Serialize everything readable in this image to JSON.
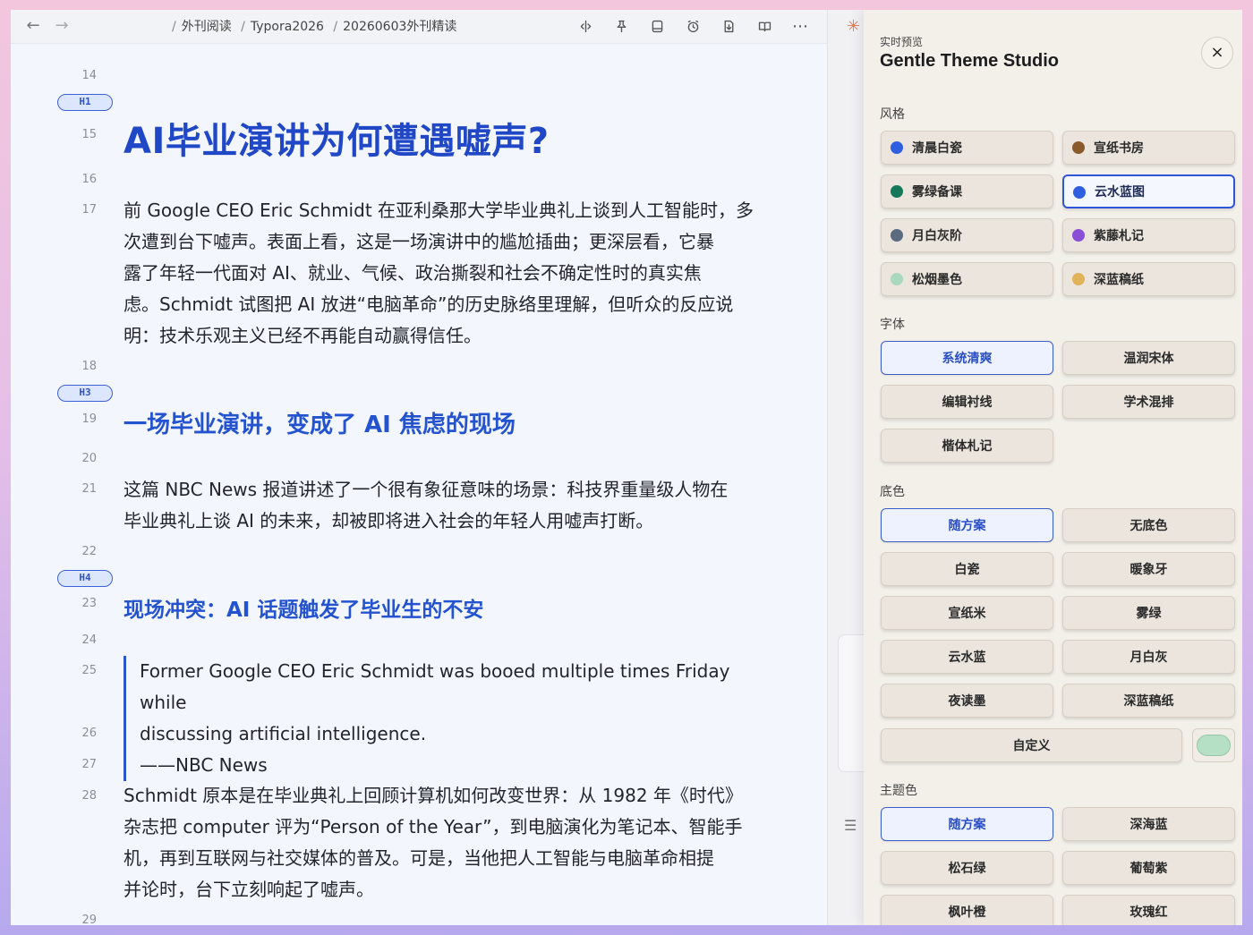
{
  "topbar": {
    "breadcrumb": [
      "外刊阅读",
      "Typora2026",
      "20260603外刊精读"
    ],
    "icons": [
      "split-view-icon",
      "pin-icon",
      "sidebar-icon",
      "timer-icon",
      "export-icon",
      "reader-icon",
      "more-icon"
    ]
  },
  "editor": {
    "line_numbers": [
      "14",
      "15",
      "16",
      "17",
      "18",
      "19",
      "20",
      "21",
      "22",
      "23",
      "24",
      "25",
      "26",
      "27",
      "28",
      "29"
    ],
    "badges": {
      "h1": "H1",
      "h3": "H3",
      "h4": "H4"
    },
    "h1": "AI毕业演讲为何遭遇嘘声?",
    "para1": [
      "前 Google CEO Eric Schmidt 在亚利桑那大学毕业典礼上谈到人工智能时，多",
      "次遭到台下嘘声。表面上看，这是一场演讲中的尴尬插曲；更深层看，它暴",
      "露了年轻一代面对 AI、就业、气候、政治撕裂和社会不确定性时的真实焦",
      "虑。Schmidt 试图把 AI 放进“电脑革命”的历史脉络里理解，但听众的反应说",
      "明：技术乐观主义已经不再能自动赢得信任。"
    ],
    "h3": "一场毕业演讲，变成了 AI 焦虑的现场",
    "para2": [
      "这篇 NBC News 报道讲述了一个很有象征意味的场景：科技界重量级人物在",
      "毕业典礼上谈 AI 的未来，却被即将进入社会的年轻人用嘘声打断。"
    ],
    "h4": "现场冲突：AI 话题触发了毕业生的不安",
    "quote": [
      "Former Google CEO Eric Schmidt was booed multiple times Friday while",
      "discussing artificial intelligence.",
      "——NBC News"
    ],
    "para3": [
      "Schmidt 原本是在毕业典礼上回顾计算机如何改变世界：从 1982 年《时代》",
      "杂志把 computer 评为“Person of the Year”，到电脑演化为笔记本、智能手",
      "机，再到互联网与社交媒体的普及。可是，当他把人工智能与电脑革命相提",
      "并论时，台下立刻响起了嘘声。"
    ]
  },
  "panel": {
    "subtitle": "实时预览",
    "title": "Gentle Theme Studio",
    "close": "×",
    "style_label": "风格",
    "styles": [
      {
        "label": "清晨白瓷",
        "color": "#2f5fe0"
      },
      {
        "label": "宣纸书房",
        "color": "#8a5a2b"
      },
      {
        "label": "雾绿备课",
        "color": "#16785a"
      },
      {
        "label": "云水蓝图",
        "color": "#2f5fe0"
      },
      {
        "label": "月白灰阶",
        "color": "#5a6b80"
      },
      {
        "label": "紫藤札记",
        "color": "#8a4fd6"
      },
      {
        "label": "松烟墨色",
        "color": "#a8d8bd"
      },
      {
        "label": "深蓝稿纸",
        "color": "#e0b25a"
      }
    ],
    "font_label": "字体",
    "fonts": [
      "系统清爽",
      "温润宋体",
      "编辑衬线",
      "学术混排",
      "楷体札记"
    ],
    "bg_label": "底色",
    "bgs": [
      "随方案",
      "无底色",
      "白瓷",
      "暖象牙",
      "宣纸米",
      "雾绿",
      "云水蓝",
      "月白灰",
      "夜读墨",
      "深蓝稿纸"
    ],
    "custom": "自定义",
    "custom_color": "#b5e0c6",
    "theme_label": "主题色",
    "themes": [
      "随方案",
      "深海蓝",
      "松石绿",
      "葡萄紫",
      "枫叶橙",
      "玫瑰红"
    ]
  }
}
